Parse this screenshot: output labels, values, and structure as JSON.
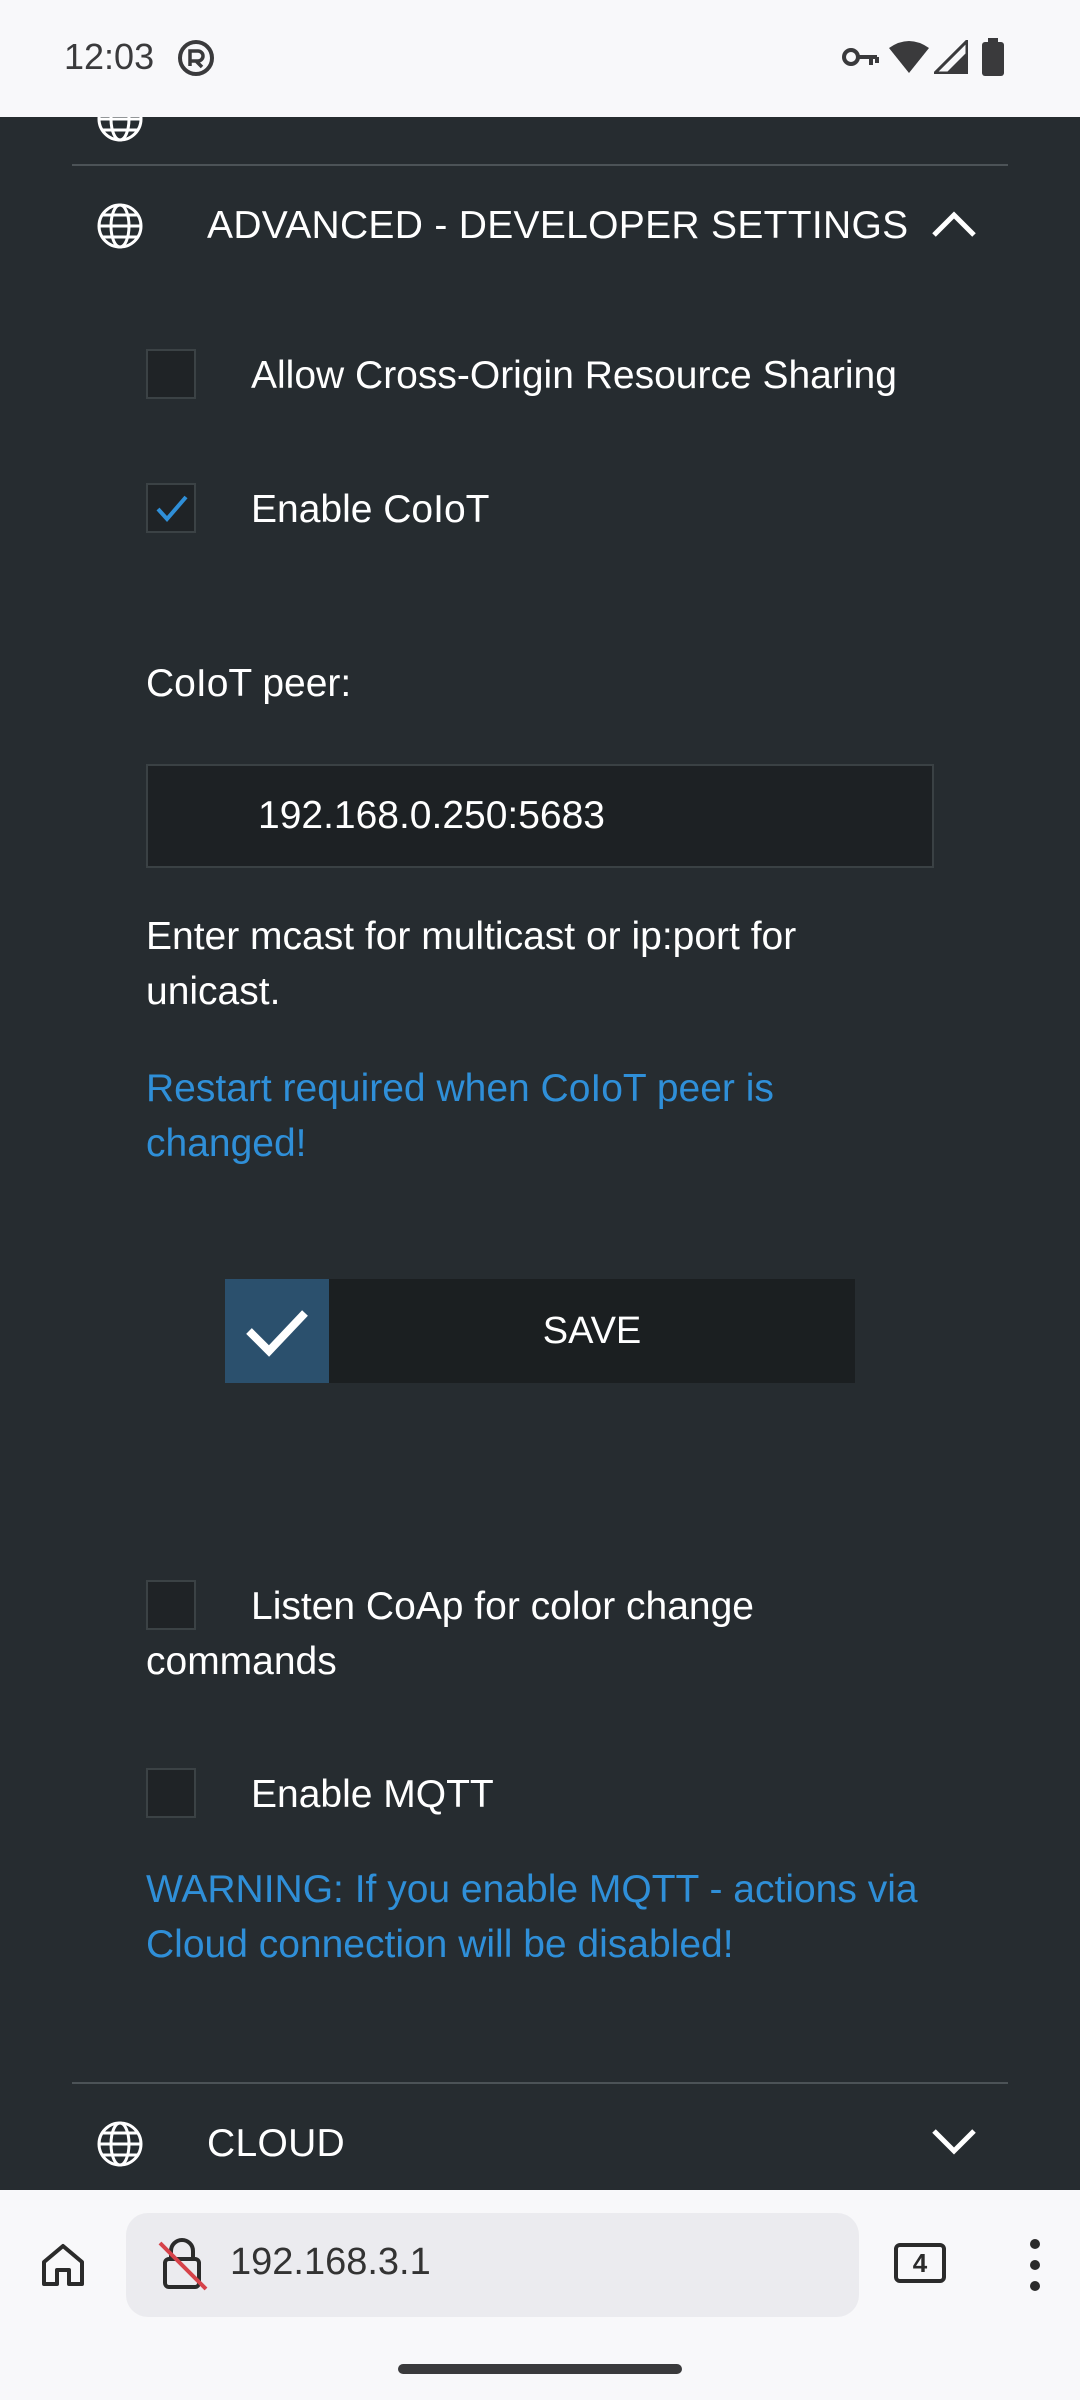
{
  "status_bar": {
    "time": "12:03"
  },
  "advanced_section": {
    "title": "ADVANCED - DEVELOPER SETTINGS"
  },
  "settings": {
    "cors_label": "Allow Cross-Origin Resource Sharing",
    "cors_checked": false,
    "coiot_label": "Enable CoIoT",
    "coiot_checked": true,
    "coiot_peer_label": "CoIoT peer:",
    "coiot_peer_value": "192.168.0.250:5683",
    "coiot_hint": "Enter mcast for multicast or ip:port for unicast.",
    "coiot_restart_note": "Restart required when CoIoT peer is changed!",
    "save_label": "SAVE",
    "coap_label": "Listen CoAp for color change commands",
    "coap_checked": false,
    "mqtt_label": "Enable MQTT",
    "mqtt_checked": false,
    "mqtt_warning": "WARNING: If you enable MQTT - actions via Cloud connection will be disabled!"
  },
  "cloud_section": {
    "title": "CLOUD"
  },
  "browser": {
    "url": "192.168.3.1",
    "tab_count": "4"
  },
  "colors": {
    "background": "#262c30",
    "accent_blue": "#2f8fd8",
    "save_icon_bg": "#2b506d"
  }
}
